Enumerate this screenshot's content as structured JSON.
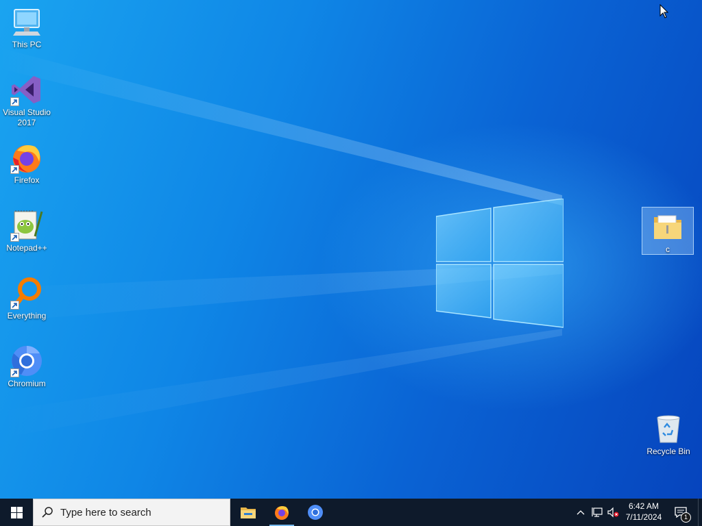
{
  "desktop": {
    "icons": [
      {
        "label": "This PC",
        "icon": "computer-icon"
      },
      {
        "label": "Visual Studio 2017",
        "icon": "visual-studio-icon"
      },
      {
        "label": "Firefox",
        "icon": "firefox-icon"
      },
      {
        "label": "Notepad++",
        "icon": "notepadpp-icon"
      },
      {
        "label": "Everything",
        "icon": "everything-icon"
      },
      {
        "label": "Chromium",
        "icon": "chromium-icon"
      },
      {
        "label": "c",
        "icon": "folder-icon"
      },
      {
        "label": "Recycle Bin",
        "icon": "recycle-bin-icon"
      }
    ]
  },
  "taskbar": {
    "search_placeholder": "Type here to search",
    "apps": [
      {
        "name": "File Explorer",
        "icon": "file-explorer-icon"
      },
      {
        "name": "Firefox",
        "icon": "firefox-icon"
      },
      {
        "name": "Chromium",
        "icon": "chromium-icon"
      }
    ],
    "clock": {
      "time": "6:42 AM",
      "date": "7/11/2024"
    },
    "notification_count": "1"
  },
  "colors": {
    "taskbar_bg": "#0e1a2b",
    "desktop_blue": "#0f86e6",
    "active_indicator": "#76b9ed"
  }
}
